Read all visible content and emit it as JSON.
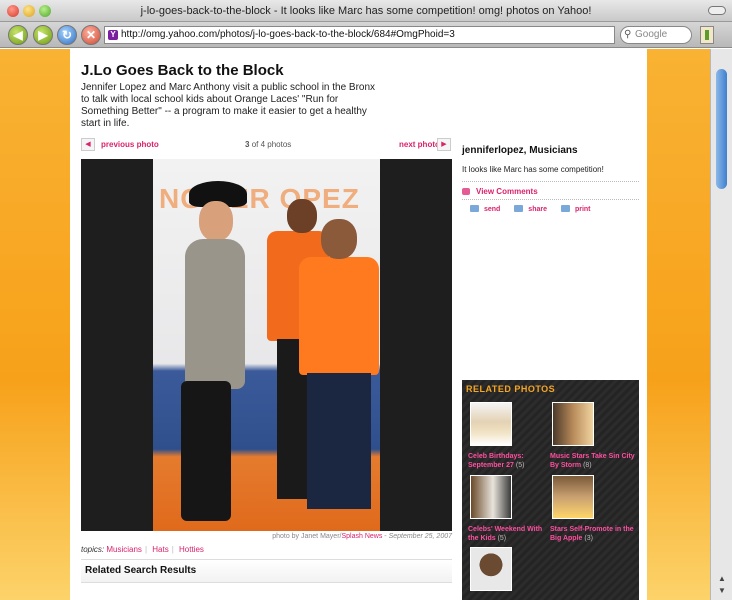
{
  "window": {
    "title": "j-lo-goes-back-to-the-block - It looks like Marc has some competition! omg! photos on Yahoo!"
  },
  "toolbar": {
    "url": "http://omg.yahoo.com/photos/j-lo-goes-back-to-the-block/684#OmgPhoid=3",
    "search_placeholder": "Google"
  },
  "article": {
    "title": "J.Lo Goes Back to the Block",
    "summary": "Jennifer Lopez and Marc Anthony visit a public school in the Bronx to talk with local school kids about Orange Laces' \"Run for Something Better\" -- a program to make it easier to get a healthy start in life."
  },
  "photo_nav": {
    "prev_label": "previous photo",
    "next_label": "next photo",
    "current": "3",
    "count_text": "of 4 photos"
  },
  "photo": {
    "credit_prefix": "photo by Janet Mayer/",
    "credit_link": "Splash News",
    "credit_date": "September 25, 2007"
  },
  "topics": {
    "label": "topics:",
    "tags": [
      "Musicians",
      "Hats",
      "Hotties"
    ]
  },
  "related_search": {
    "title": "Related Search Results"
  },
  "sidebar": {
    "title": "jenniferlopez, Musicians",
    "caption": "It looks like Marc has some competition!",
    "view_comments": "View Comments",
    "send": "send",
    "share": "share",
    "print": "print"
  },
  "related_photos": {
    "title": "RELATED PHOTOS",
    "items": [
      {
        "label": "Celeb Birthdays: September 27",
        "count": "(5)"
      },
      {
        "label": "Music Stars Take Sin City By Storm",
        "count": "(8)"
      },
      {
        "label": "Celebs' Weekend With the Kids",
        "count": "(5)"
      },
      {
        "label": "Stars Self-Promote in the Big Apple",
        "count": "(3)"
      }
    ]
  },
  "colors": {
    "accent_pink": "#d8236b",
    "related_title_orange": "#f6a623",
    "page_orange": "#f7a11a"
  }
}
